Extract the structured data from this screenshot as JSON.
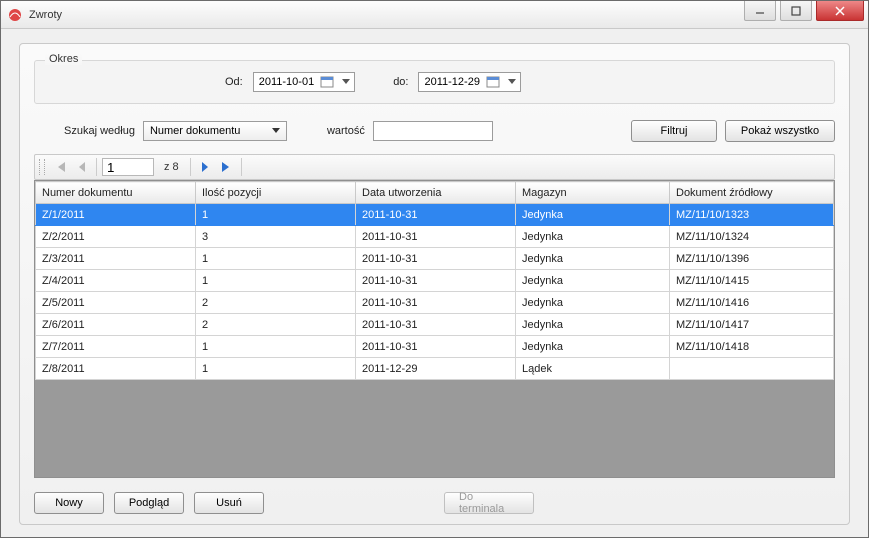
{
  "window": {
    "title": "Zwroty"
  },
  "okres": {
    "legend": "Okres",
    "od_label": "Od:",
    "od_value": "2011-10-01",
    "do_label": "do:",
    "do_value": "2011-12-29"
  },
  "filter": {
    "szukaj_label": "Szukaj według",
    "combo_value": "Numer dokumentu",
    "wartosc_label": "wartość",
    "wartosc_value": "",
    "filtruj_label": "Filtruj",
    "pokaz_label": "Pokaż wszystko"
  },
  "nav": {
    "page": "1",
    "z_label": "z 8"
  },
  "columns": {
    "c0": "Numer dokumentu",
    "c1": "Ilość pozycji",
    "c2": "Data utworzenia",
    "c3": "Magazyn",
    "c4": "Dokument źródłowy"
  },
  "rows": [
    {
      "c0": "Z/1/2011",
      "c1": "1",
      "c2": "2011-10-31",
      "c3": "Jedynka",
      "c4": "MZ/11/10/1323",
      "selected": true
    },
    {
      "c0": "Z/2/2011",
      "c1": "3",
      "c2": "2011-10-31",
      "c3": "Jedynka",
      "c4": "MZ/11/10/1324"
    },
    {
      "c0": "Z/3/2011",
      "c1": "1",
      "c2": "2011-10-31",
      "c3": "Jedynka",
      "c4": "MZ/11/10/1396"
    },
    {
      "c0": "Z/4/2011",
      "c1": "1",
      "c2": "2011-10-31",
      "c3": "Jedynka",
      "c4": "MZ/11/10/1415"
    },
    {
      "c0": "Z/5/2011",
      "c1": "2",
      "c2": "2011-10-31",
      "c3": "Jedynka",
      "c4": "MZ/11/10/1416"
    },
    {
      "c0": "Z/6/2011",
      "c1": "2",
      "c2": "2011-10-31",
      "c3": "Jedynka",
      "c4": "MZ/11/10/1417"
    },
    {
      "c0": "Z/7/2011",
      "c1": "1",
      "c2": "2011-10-31",
      "c3": "Jedynka",
      "c4": "MZ/11/10/1418"
    },
    {
      "c0": "Z/8/2011",
      "c1": "1",
      "c2": "2011-12-29",
      "c3": "Lądek",
      "c4": ""
    }
  ],
  "footer": {
    "nowy": "Nowy",
    "podglad": "Podgląd",
    "usun": "Usuń",
    "do_terminala": "Do terminala"
  }
}
